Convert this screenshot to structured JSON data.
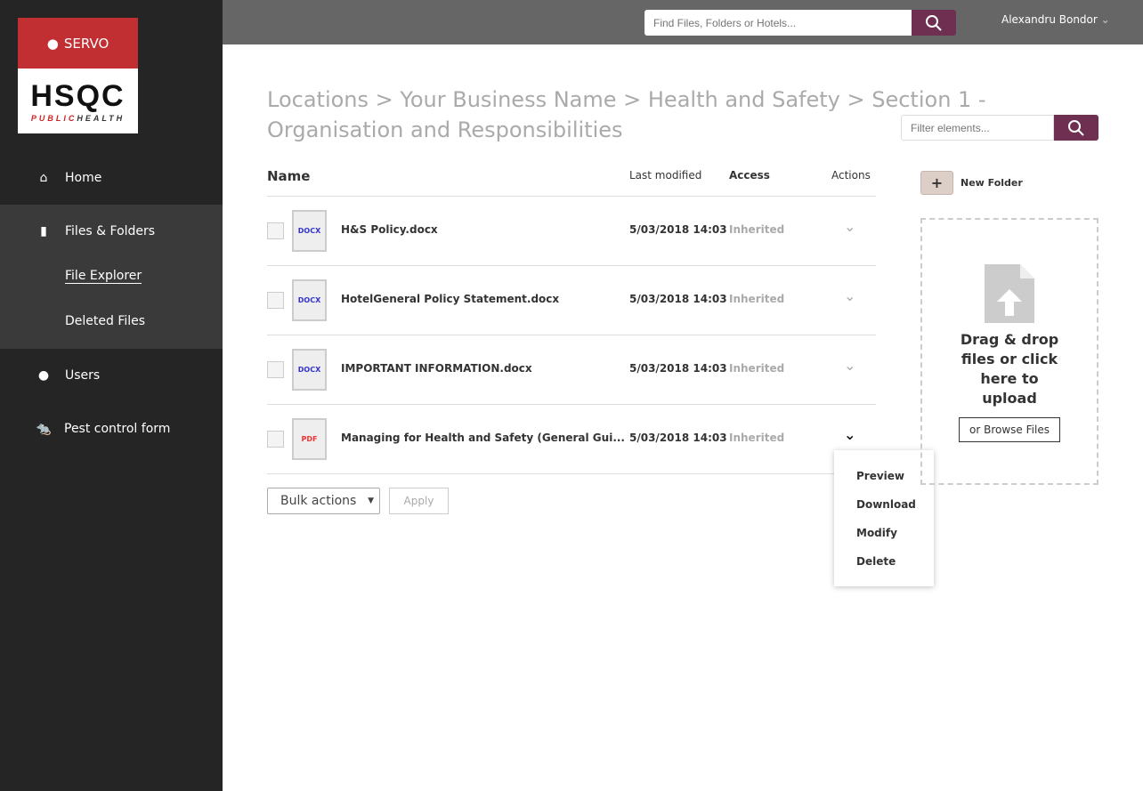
{
  "brand": {
    "top": "SERVO",
    "logo": "HSQC",
    "logo_sub_red": "PUBLIC",
    "logo_sub_black": "HEALTH"
  },
  "sidebar": {
    "items": [
      {
        "label": "Home",
        "icon": "home-icon"
      },
      {
        "label": "Files & Folders",
        "icon": "file-icon"
      },
      {
        "label": "File Explorer"
      },
      {
        "label": "Deleted Files"
      },
      {
        "label": "Users",
        "icon": "user-icon"
      },
      {
        "label": "Pest control form",
        "icon": "rat-icon"
      }
    ]
  },
  "topbar": {
    "search_placeholder": "Find Files, Folders or Hotels...",
    "user": "Alexandru Bondor"
  },
  "breadcrumb": "Locations > Your Business Name > Health and Safety > Section 1 - Organisation and Responsibilities",
  "filter_placeholder": "Filter elements...",
  "table": {
    "headers": {
      "name": "Name",
      "modified": "Last modified",
      "access": "Access",
      "actions": "Actions"
    },
    "rows": [
      {
        "type": "DOCX",
        "name": "H&S Policy.docx",
        "modified": "5/03/2018 14:03",
        "access": "Inherited"
      },
      {
        "type": "DOCX",
        "name": "HotelGeneral Policy Statement.docx",
        "modified": "5/03/2018 14:03",
        "access": "Inherited"
      },
      {
        "type": "DOCX",
        "name": "IMPORTANT INFORMATION.docx",
        "modified": "5/03/2018 14:03",
        "access": "Inherited"
      },
      {
        "type": "PDF",
        "name": "Managing for Health and Safety (General Gui...",
        "modified": "5/03/2018 14:03",
        "access": "Inherited"
      }
    ]
  },
  "bulk": {
    "select": "Bulk actions",
    "apply": "Apply"
  },
  "menu": [
    "Preview",
    "Download",
    "Modify",
    "Delete"
  ],
  "new_folder": "New Folder",
  "upload": {
    "text": "Drag & drop files or click here to upload",
    "browse": "or Browse Files"
  },
  "colors": {
    "accent": "#6f2f50",
    "brand_red": "#c12f33"
  }
}
